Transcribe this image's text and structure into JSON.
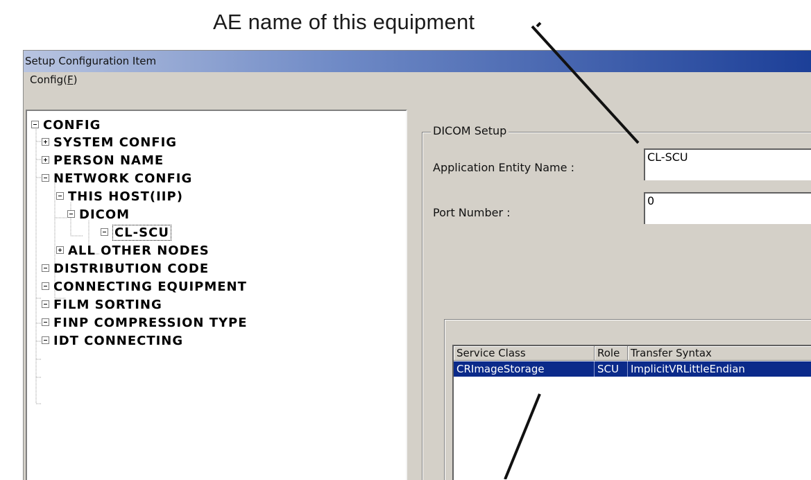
{
  "annotation": {
    "caption": "AE name of this equipment"
  },
  "window": {
    "title": "Setup Configuration Item",
    "menu": {
      "config_label": "Config(",
      "config_accel": "F",
      "config_close": ")"
    }
  },
  "tree": {
    "root": "CONFIG",
    "items": [
      {
        "label": "SYSTEM CONFIG",
        "expander": "plus"
      },
      {
        "label": "PERSON NAME",
        "expander": "plus"
      },
      {
        "label": "NETWORK CONFIG",
        "expander": "minus"
      },
      {
        "label": "THIS HOST(IIP)",
        "expander": "minus"
      },
      {
        "label": "DICOM",
        "expander": "minus"
      },
      {
        "label": "CL-SCU",
        "expander": "minus",
        "selected": true
      },
      {
        "label": "ALL OTHER NODES",
        "expander": "plus"
      },
      {
        "label": "DISTRIBUTION CODE",
        "expander": "minus"
      },
      {
        "label": "CONNECTING EQUIPMENT",
        "expander": "minus"
      },
      {
        "label": "FILM SORTING",
        "expander": "minus"
      },
      {
        "label": "FINP COMPRESSION TYPE",
        "expander": "minus"
      },
      {
        "label": "IDT CONNECTING",
        "expander": "minus"
      }
    ]
  },
  "dicom_setup": {
    "group_title": "DICOM Setup",
    "ae_name_label": "Application Entity Name :",
    "ae_name_value": "CL-SCU",
    "port_label": "Port Number :",
    "port_value": "0"
  },
  "services": {
    "columns": [
      "Service Class",
      "Role",
      "Transfer Syntax"
    ],
    "rows": [
      {
        "service_class": "CRImageStorage",
        "role": "SCU",
        "transfer_syntax": "ImplicitVRLittleEndian",
        "selected": true
      }
    ]
  },
  "colors": {
    "dialog_bg": "#d4d0c8",
    "titlebar_dark": "#1c3f98",
    "selection": "#0b2a8a"
  }
}
